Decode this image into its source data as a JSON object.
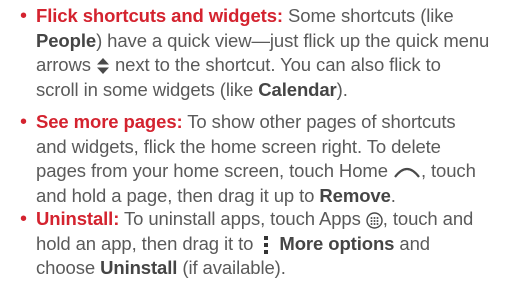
{
  "bullets": [
    {
      "term": "Flick shortcuts and widgets:",
      "l1_rest": " Some shortcuts (like",
      "l2_bold": "People",
      "l2_rest": ") have a quick view—just flick up the quick menu",
      "l3_pre": "arrows ",
      "l3_post": " next to the shortcut. You can also flick to",
      "l4_pre": "scroll in some widgets (like ",
      "l4_bold": "Calendar",
      "l4_post": ")."
    },
    {
      "term": "See more pages:",
      "l1_rest": " To show other pages of shortcuts",
      "l2": "and widgets, flick the home screen right. To delete",
      "l3_pre": "pages from your home screen, touch Home ",
      "l3_post": ", touch",
      "l4_pre": "and hold a page, then drag it up to ",
      "l4_bold": "Remove",
      "l4_post": "."
    },
    {
      "term": "Uninstall:",
      "l1_pre": " To uninstall apps, touch Apps ",
      "l1_post": ", touch and",
      "l2_pre": "hold an app, then drag it to ",
      "l2_bold": "More options",
      "l2_post": " and",
      "l3_pre": "choose ",
      "l3_bold": "Uninstall",
      "l3_post": " (if available)."
    }
  ],
  "icons": [
    "bullet-icon",
    "quick-menu-arrows-icon",
    "home-icon",
    "apps-icon",
    "more-options-icon"
  ],
  "colors": {
    "accent": "#d4232f",
    "text": "#5a5a5a"
  }
}
